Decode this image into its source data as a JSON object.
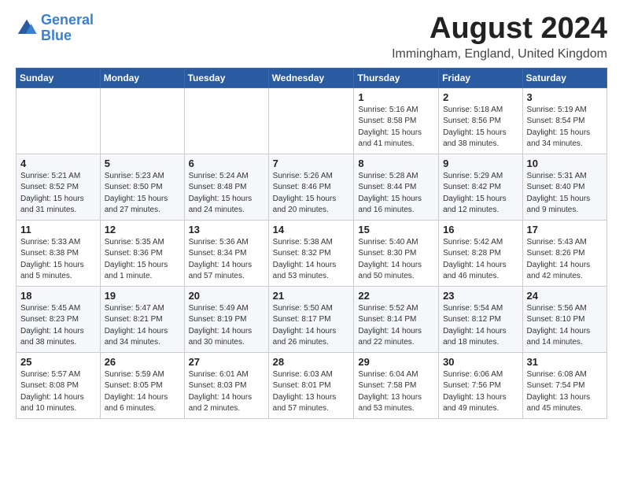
{
  "header": {
    "logo_line1": "General",
    "logo_line2": "Blue",
    "month_year": "August 2024",
    "location": "Immingham, England, United Kingdom"
  },
  "weekdays": [
    "Sunday",
    "Monday",
    "Tuesday",
    "Wednesday",
    "Thursday",
    "Friday",
    "Saturday"
  ],
  "weeks": [
    [
      {
        "day": "",
        "info": ""
      },
      {
        "day": "",
        "info": ""
      },
      {
        "day": "",
        "info": ""
      },
      {
        "day": "",
        "info": ""
      },
      {
        "day": "1",
        "info": "Sunrise: 5:16 AM\nSunset: 8:58 PM\nDaylight: 15 hours\nand 41 minutes."
      },
      {
        "day": "2",
        "info": "Sunrise: 5:18 AM\nSunset: 8:56 PM\nDaylight: 15 hours\nand 38 minutes."
      },
      {
        "day": "3",
        "info": "Sunrise: 5:19 AM\nSunset: 8:54 PM\nDaylight: 15 hours\nand 34 minutes."
      }
    ],
    [
      {
        "day": "4",
        "info": "Sunrise: 5:21 AM\nSunset: 8:52 PM\nDaylight: 15 hours\nand 31 minutes."
      },
      {
        "day": "5",
        "info": "Sunrise: 5:23 AM\nSunset: 8:50 PM\nDaylight: 15 hours\nand 27 minutes."
      },
      {
        "day": "6",
        "info": "Sunrise: 5:24 AM\nSunset: 8:48 PM\nDaylight: 15 hours\nand 24 minutes."
      },
      {
        "day": "7",
        "info": "Sunrise: 5:26 AM\nSunset: 8:46 PM\nDaylight: 15 hours\nand 20 minutes."
      },
      {
        "day": "8",
        "info": "Sunrise: 5:28 AM\nSunset: 8:44 PM\nDaylight: 15 hours\nand 16 minutes."
      },
      {
        "day": "9",
        "info": "Sunrise: 5:29 AM\nSunset: 8:42 PM\nDaylight: 15 hours\nand 12 minutes."
      },
      {
        "day": "10",
        "info": "Sunrise: 5:31 AM\nSunset: 8:40 PM\nDaylight: 15 hours\nand 9 minutes."
      }
    ],
    [
      {
        "day": "11",
        "info": "Sunrise: 5:33 AM\nSunset: 8:38 PM\nDaylight: 15 hours\nand 5 minutes."
      },
      {
        "day": "12",
        "info": "Sunrise: 5:35 AM\nSunset: 8:36 PM\nDaylight: 15 hours\nand 1 minute."
      },
      {
        "day": "13",
        "info": "Sunrise: 5:36 AM\nSunset: 8:34 PM\nDaylight: 14 hours\nand 57 minutes."
      },
      {
        "day": "14",
        "info": "Sunrise: 5:38 AM\nSunset: 8:32 PM\nDaylight: 14 hours\nand 53 minutes."
      },
      {
        "day": "15",
        "info": "Sunrise: 5:40 AM\nSunset: 8:30 PM\nDaylight: 14 hours\nand 50 minutes."
      },
      {
        "day": "16",
        "info": "Sunrise: 5:42 AM\nSunset: 8:28 PM\nDaylight: 14 hours\nand 46 minutes."
      },
      {
        "day": "17",
        "info": "Sunrise: 5:43 AM\nSunset: 8:26 PM\nDaylight: 14 hours\nand 42 minutes."
      }
    ],
    [
      {
        "day": "18",
        "info": "Sunrise: 5:45 AM\nSunset: 8:23 PM\nDaylight: 14 hours\nand 38 minutes."
      },
      {
        "day": "19",
        "info": "Sunrise: 5:47 AM\nSunset: 8:21 PM\nDaylight: 14 hours\nand 34 minutes."
      },
      {
        "day": "20",
        "info": "Sunrise: 5:49 AM\nSunset: 8:19 PM\nDaylight: 14 hours\nand 30 minutes."
      },
      {
        "day": "21",
        "info": "Sunrise: 5:50 AM\nSunset: 8:17 PM\nDaylight: 14 hours\nand 26 minutes."
      },
      {
        "day": "22",
        "info": "Sunrise: 5:52 AM\nSunset: 8:14 PM\nDaylight: 14 hours\nand 22 minutes."
      },
      {
        "day": "23",
        "info": "Sunrise: 5:54 AM\nSunset: 8:12 PM\nDaylight: 14 hours\nand 18 minutes."
      },
      {
        "day": "24",
        "info": "Sunrise: 5:56 AM\nSunset: 8:10 PM\nDaylight: 14 hours\nand 14 minutes."
      }
    ],
    [
      {
        "day": "25",
        "info": "Sunrise: 5:57 AM\nSunset: 8:08 PM\nDaylight: 14 hours\nand 10 minutes."
      },
      {
        "day": "26",
        "info": "Sunrise: 5:59 AM\nSunset: 8:05 PM\nDaylight: 14 hours\nand 6 minutes."
      },
      {
        "day": "27",
        "info": "Sunrise: 6:01 AM\nSunset: 8:03 PM\nDaylight: 14 hours\nand 2 minutes."
      },
      {
        "day": "28",
        "info": "Sunrise: 6:03 AM\nSunset: 8:01 PM\nDaylight: 13 hours\nand 57 minutes."
      },
      {
        "day": "29",
        "info": "Sunrise: 6:04 AM\nSunset: 7:58 PM\nDaylight: 13 hours\nand 53 minutes."
      },
      {
        "day": "30",
        "info": "Sunrise: 6:06 AM\nSunset: 7:56 PM\nDaylight: 13 hours\nand 49 minutes."
      },
      {
        "day": "31",
        "info": "Sunrise: 6:08 AM\nSunset: 7:54 PM\nDaylight: 13 hours\nand 45 minutes."
      }
    ]
  ]
}
